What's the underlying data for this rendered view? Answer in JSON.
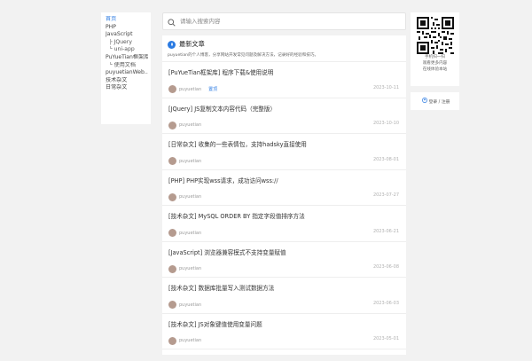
{
  "sidebar": {
    "items": [
      {
        "label": "首页",
        "sub": false,
        "active": true
      },
      {
        "label": "PHP",
        "sub": false,
        "active": false
      },
      {
        "label": "JavaScript",
        "sub": false,
        "active": false
      },
      {
        "label": "├ JQuery",
        "sub": true,
        "active": false
      },
      {
        "label": "└ uni-app",
        "sub": true,
        "active": false
      },
      {
        "label": "PuYueTian框架库",
        "sub": false,
        "active": false
      },
      {
        "label": "└ 使用文档",
        "sub": true,
        "active": false
      },
      {
        "label": "puyuetianWeb...",
        "sub": false,
        "active": false
      },
      {
        "label": "技术杂文",
        "sub": false,
        "active": false
      },
      {
        "label": "日常杂文",
        "sub": false,
        "active": false
      }
    ]
  },
  "search": {
    "placeholder": "请输入搜索内容",
    "icon": "search-icon"
  },
  "feed": {
    "title": "最新文章",
    "description": "puyuetian的个人博客，分享网站开发常见问题及解决方法，记录好的经验和技巧。",
    "articles": [
      {
        "title": "[PuYueTian框架库] 程序下载&使用说明",
        "author": "puyuetian",
        "tag": "置顶",
        "date": "2023-10-11"
      },
      {
        "title": "[JQuery] JS复制文本内容代码（完整版）",
        "author": "puyuetian",
        "tag": "",
        "date": "2023-10-10"
      },
      {
        "title": "[日常杂文] 收集的一些表情包，支持hadsky直接使用",
        "author": "puyuetian",
        "tag": "",
        "date": "2023-08-01"
      },
      {
        "title": "[PHP] PHP实现wss请求，成功访问wss://",
        "author": "puyuetian",
        "tag": "",
        "date": "2023-07-27"
      },
      {
        "title": "[技术杂文] MySQL ORDER BY 指定字段值排序方法",
        "author": "puyuetian",
        "tag": "",
        "date": "2023-06-21"
      },
      {
        "title": "[JavaScript] 浏览器兼容模式不支持变量赋值",
        "author": "puyuetian",
        "tag": "",
        "date": "2023-06-08"
      },
      {
        "title": "[技术杂文] 数据库批量写入测试数据方法",
        "author": "puyuetian",
        "tag": "",
        "date": "2023-06-03"
      },
      {
        "title": "[技术杂文] JS对象键值使用变量问题",
        "author": "puyuetian",
        "tag": "",
        "date": "2023-05-01"
      }
    ]
  },
  "qr": {
    "lines": [
      "手机扫一扫",
      "观看更多内容",
      "在线体验本站"
    ]
  },
  "login": {
    "label": "登录 / 注册"
  },
  "colors": {
    "accent": "#2a7ae2",
    "background": "#f2f2f2",
    "avatar": "#b59b8f"
  }
}
